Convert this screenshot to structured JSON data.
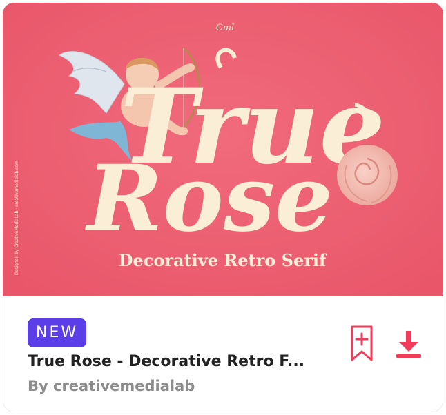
{
  "card": {
    "badge": "NEW",
    "title": "True Rose - Decorative Retro F...",
    "author": "By creativemedialab"
  },
  "thumbnail": {
    "headline_line1": "True",
    "headline_line2": "Rose",
    "tagline": "Decorative Retro Serif",
    "brand_mark": "Cml",
    "side_credit": "Designed by CreativeMediaLab · creativemedialab.com",
    "background_color": "#ec5a6e",
    "lettering_color": "#fbeed6"
  },
  "icons": {
    "bookmark": "bookmark-add-icon",
    "download": "download-icon"
  },
  "colors": {
    "accent": "#f23b5a",
    "badge": "#5b3ee8"
  }
}
